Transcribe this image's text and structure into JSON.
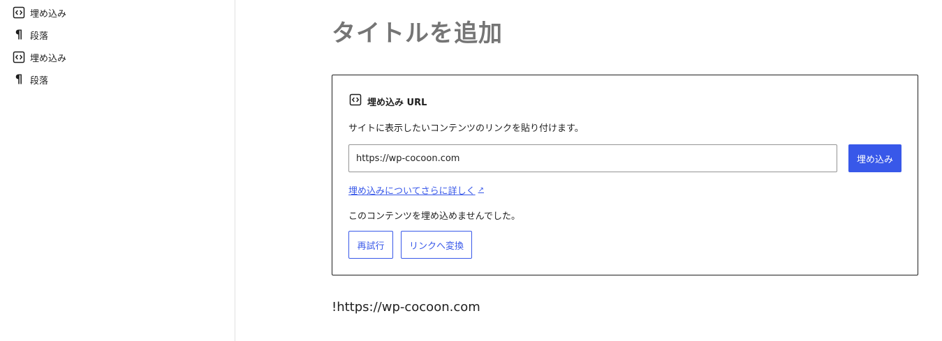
{
  "list_view": {
    "items": [
      {
        "label": "埋め込み",
        "icon": "embed-icon"
      },
      {
        "label": "段落",
        "icon": "paragraph-icon"
      },
      {
        "label": "埋め込み",
        "icon": "embed-icon"
      },
      {
        "label": "段落",
        "icon": "paragraph-icon"
      }
    ]
  },
  "editor": {
    "title_placeholder": "タイトルを追加",
    "embed": {
      "header_label": "埋め込み URL",
      "instructions": "サイトに表示したいコンテンツのリンクを貼り付けます。",
      "url_value": "https://wp-cocoon.com",
      "embed_button": "埋め込み",
      "learn_more": "埋め込みについてさらに詳しく",
      "learn_more_ext": "↗",
      "error": "このコンテンツを埋め込めませんでした。",
      "retry_button": "再試行",
      "convert_button": "リンクへ変換"
    },
    "paragraph_text": "!https://wp-cocoon.com"
  },
  "colors": {
    "accent": "#3858e9",
    "title_placeholder": "#757575",
    "text": "#1e1e1e"
  }
}
